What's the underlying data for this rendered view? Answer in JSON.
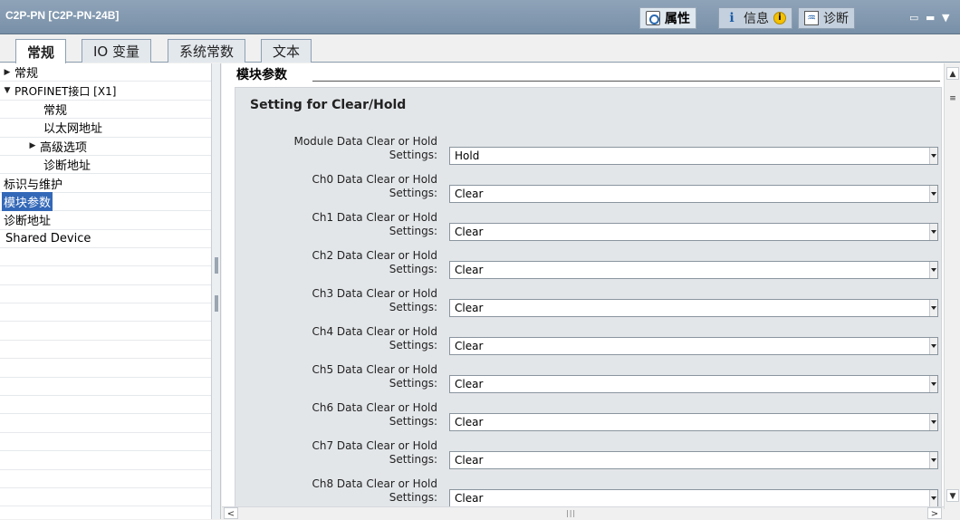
{
  "window": {
    "title": "C2P-PN [C2P-PN-24B]",
    "inspector_tabs": [
      {
        "label": "属性",
        "icon": "properties-icon"
      },
      {
        "label": "信息",
        "icon": "info-icon"
      },
      {
        "label": "诊断",
        "icon": "diagnostics-icon"
      }
    ],
    "info_badge": "i"
  },
  "tabs": [
    {
      "label": "常规"
    },
    {
      "label": "IO 变量"
    },
    {
      "label": "系统常数"
    },
    {
      "label": "文本"
    }
  ],
  "tree": [
    {
      "label": "常规",
      "arrow": "▶"
    },
    {
      "label": "PROFINET接口 [X1]",
      "arrow": "▼"
    },
    {
      "label": "常规",
      "arrow": ""
    },
    {
      "label": "以太网地址",
      "arrow": ""
    },
    {
      "label": "高级选项",
      "arrow": "▶"
    },
    {
      "label": "诊断地址",
      "arrow": ""
    },
    {
      "label": "标识与维护",
      "arrow": ""
    },
    {
      "label": "模块参数",
      "arrow": ""
    },
    {
      "label": "诊断地址",
      "arrow": ""
    },
    {
      "label": "Shared Device",
      "arrow": ""
    }
  ],
  "content": {
    "section_title": "模块参数",
    "group_title": "Setting for Clear/Hold",
    "params": [
      {
        "label_line1": "Module Data Clear or Hold",
        "label_line2": "Settings:",
        "value": "Hold"
      },
      {
        "label_line1": "Ch0 Data Clear or Hold",
        "label_line2": "Settings:",
        "value": "Clear"
      },
      {
        "label_line1": "Ch1 Data Clear or Hold",
        "label_line2": "Settings:",
        "value": "Clear"
      },
      {
        "label_line1": "Ch2 Data Clear or Hold",
        "label_line2": "Settings:",
        "value": "Clear"
      },
      {
        "label_line1": "Ch3 Data Clear or Hold",
        "label_line2": "Settings:",
        "value": "Clear"
      },
      {
        "label_line1": "Ch4 Data Clear or Hold",
        "label_line2": "Settings:",
        "value": "Clear"
      },
      {
        "label_line1": "Ch5 Data Clear or Hold",
        "label_line2": "Settings:",
        "value": "Clear"
      },
      {
        "label_line1": "Ch6 Data Clear or Hold",
        "label_line2": "Settings:",
        "value": "Clear"
      },
      {
        "label_line1": "Ch7 Data Clear or Hold",
        "label_line2": "Settings:",
        "value": "Clear"
      },
      {
        "label_line1": "Ch8 Data Clear or Hold",
        "label_line2": "Settings:",
        "value": "Clear"
      }
    ]
  }
}
